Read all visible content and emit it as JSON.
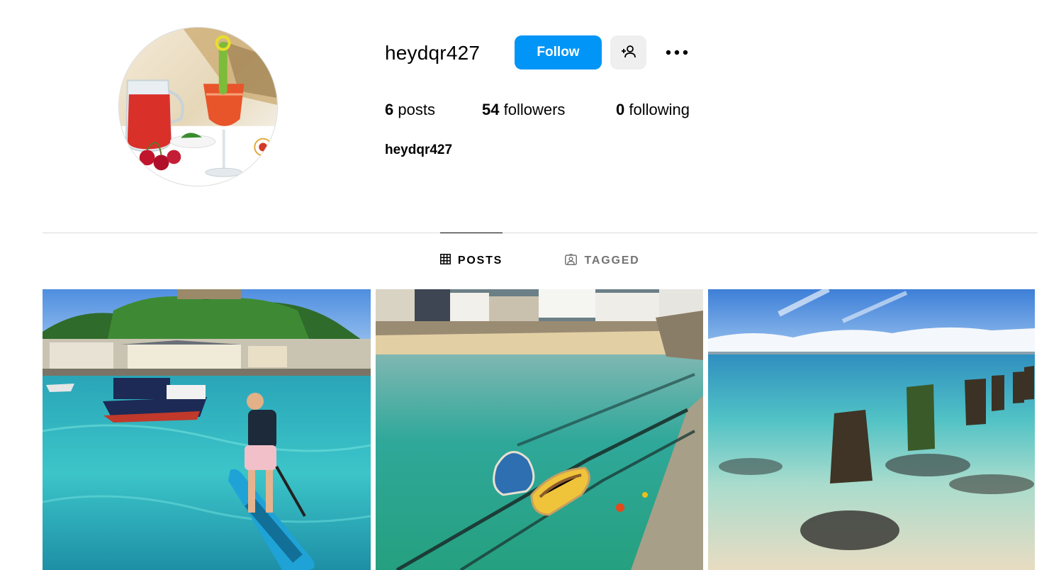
{
  "profile": {
    "username": "heydqr427",
    "display_name": "heydqr427",
    "avatar_alt": "profile picture"
  },
  "actions": {
    "follow_label": "Follow",
    "suggest_icon": "person-add-icon",
    "more_icon": "more-horizontal-icon"
  },
  "stats": {
    "posts_count": "6",
    "posts_label": "posts",
    "followers_count": "54",
    "followers_label": "followers",
    "following_count": "0",
    "following_label": "following"
  },
  "tabs": [
    {
      "label": "POSTS",
      "icon": "grid-icon",
      "active": true
    },
    {
      "label": "TAGGED",
      "icon": "tagged-icon",
      "active": false
    }
  ],
  "posts": [
    {
      "subject": "paddleboarder in harbour"
    },
    {
      "subject": "rowing boats at harbour beach"
    },
    {
      "subject": "wooden posts in clear sea"
    }
  ],
  "colors": {
    "accent": "#0095f6",
    "secondary_button": "#efefef",
    "divider": "#dbdbdb",
    "inactive_tab": "#737373"
  }
}
